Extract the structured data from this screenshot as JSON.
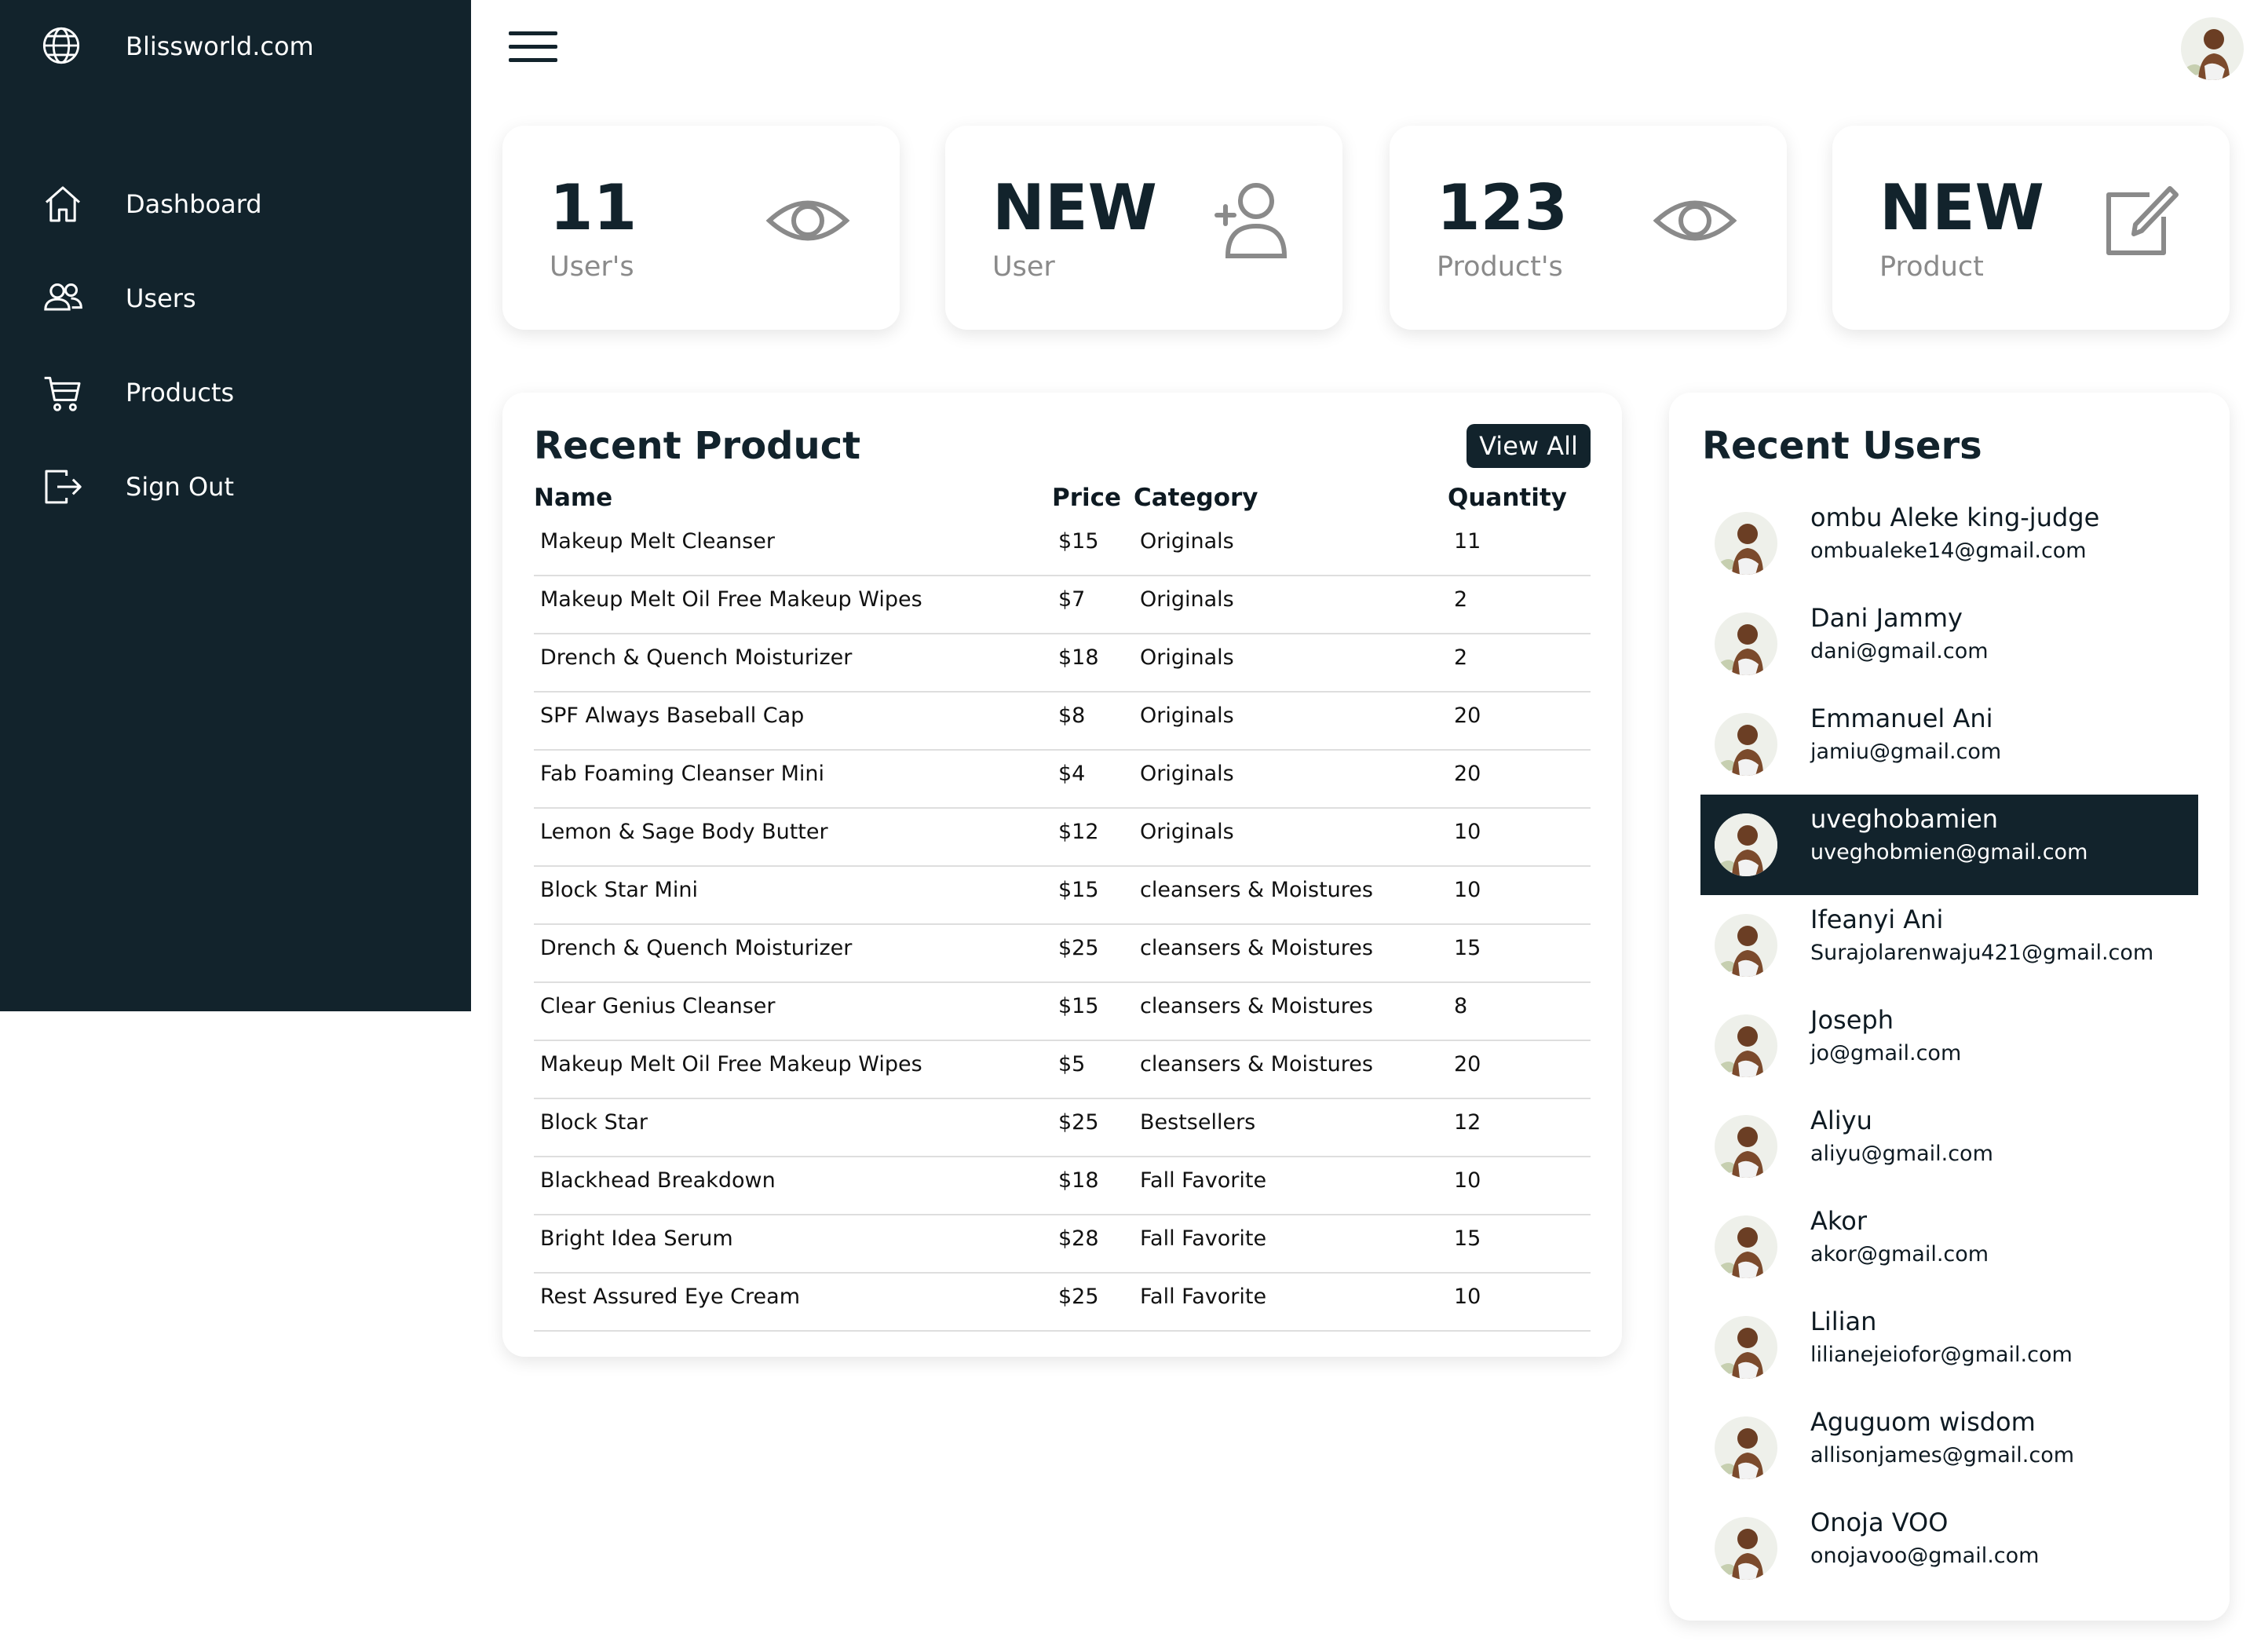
{
  "brand": {
    "name": "Blissworld.com",
    "icon": "globe-icon"
  },
  "sidebar": {
    "items": [
      {
        "label": "Dashboard",
        "icon": "home-icon"
      },
      {
        "label": "Users",
        "icon": "users-icon"
      },
      {
        "label": "Products",
        "icon": "cart-icon"
      },
      {
        "label": "Sign Out",
        "icon": "sign-out-icon"
      }
    ]
  },
  "header": {
    "menu_icon": "hamburger-menu-icon",
    "avatar_icon": "user-avatar"
  },
  "stats": [
    {
      "value": "11",
      "label": "User's",
      "icon": "eye-icon"
    },
    {
      "value": "NEW",
      "label": "User",
      "icon": "add-user-icon"
    },
    {
      "value": "123",
      "label": "Product's",
      "icon": "eye-icon"
    },
    {
      "value": "NEW",
      "label": "Product",
      "icon": "edit-icon"
    }
  ],
  "recent_products": {
    "title": "Recent Product",
    "view_all": "View All",
    "columns": [
      "Name",
      "Price",
      "Category",
      "Quantity"
    ],
    "rows": [
      [
        "Makeup Melt Cleanser",
        "$15",
        "Originals",
        "11"
      ],
      [
        "Makeup Melt Oil Free Makeup Wipes",
        "$7",
        "Originals",
        "2"
      ],
      [
        "Drench & Quench Moisturizer",
        "$18",
        "Originals",
        "2"
      ],
      [
        "SPF Always Baseball Cap",
        "$8",
        "Originals",
        "20"
      ],
      [
        "Fab Foaming Cleanser Mini",
        "$4",
        "Originals",
        "20"
      ],
      [
        "Lemon & Sage Body Butter",
        "$12",
        "Originals",
        "10"
      ],
      [
        "Block Star Mini",
        "$15",
        "cleansers & Moistures",
        "10"
      ],
      [
        "Drench & Quench Moisturizer",
        "$25",
        "cleansers & Moistures",
        "15"
      ],
      [
        "Clear Genius Cleanser",
        "$15",
        "cleansers & Moistures",
        "8"
      ],
      [
        "Makeup Melt Oil Free Makeup Wipes",
        "$5",
        "cleansers & Moistures",
        "20"
      ],
      [
        "Block Star",
        "$25",
        "Bestsellers",
        "12"
      ],
      [
        "Blackhead Breakdown",
        "$18",
        "Fall Favorite",
        "10"
      ],
      [
        "Bright Idea Serum",
        "$28",
        "Fall Favorite",
        "15"
      ],
      [
        "Rest Assured Eye Cream",
        "$25",
        "Fall Favorite",
        "10"
      ]
    ]
  },
  "recent_users": {
    "title": "Recent Users",
    "users": [
      {
        "name": "ombu Aleke king-judge",
        "email": "ombualeke14@gmail.com",
        "active": false
      },
      {
        "name": "Dani Jammy",
        "email": "dani@gmail.com",
        "active": false
      },
      {
        "name": "Emmanuel Ani",
        "email": "jamiu@gmail.com",
        "active": false
      },
      {
        "name": "uveghobamien",
        "email": "uveghobmien@gmail.com",
        "active": true
      },
      {
        "name": "Ifeanyi Ani",
        "email": "Surajolarenwaju421@gmail.com",
        "active": false
      },
      {
        "name": "Joseph",
        "email": "jo@gmail.com",
        "active": false
      },
      {
        "name": "Aliyu",
        "email": "aliyu@gmail.com",
        "active": false
      },
      {
        "name": "Akor",
        "email": "akor@gmail.com",
        "active": false
      },
      {
        "name": "Lilian",
        "email": "lilianejeiofor@gmail.com",
        "active": false
      },
      {
        "name": "Aguguom wisdom",
        "email": "allisonjames@gmail.com",
        "active": false
      },
      {
        "name": "Onoja VOO",
        "email": "onojavoo@gmail.com",
        "active": false
      }
    ]
  },
  "colors": {
    "sidebar_bg": "#12232c",
    "accent": "#12232c",
    "muted": "#8a8a8a"
  }
}
